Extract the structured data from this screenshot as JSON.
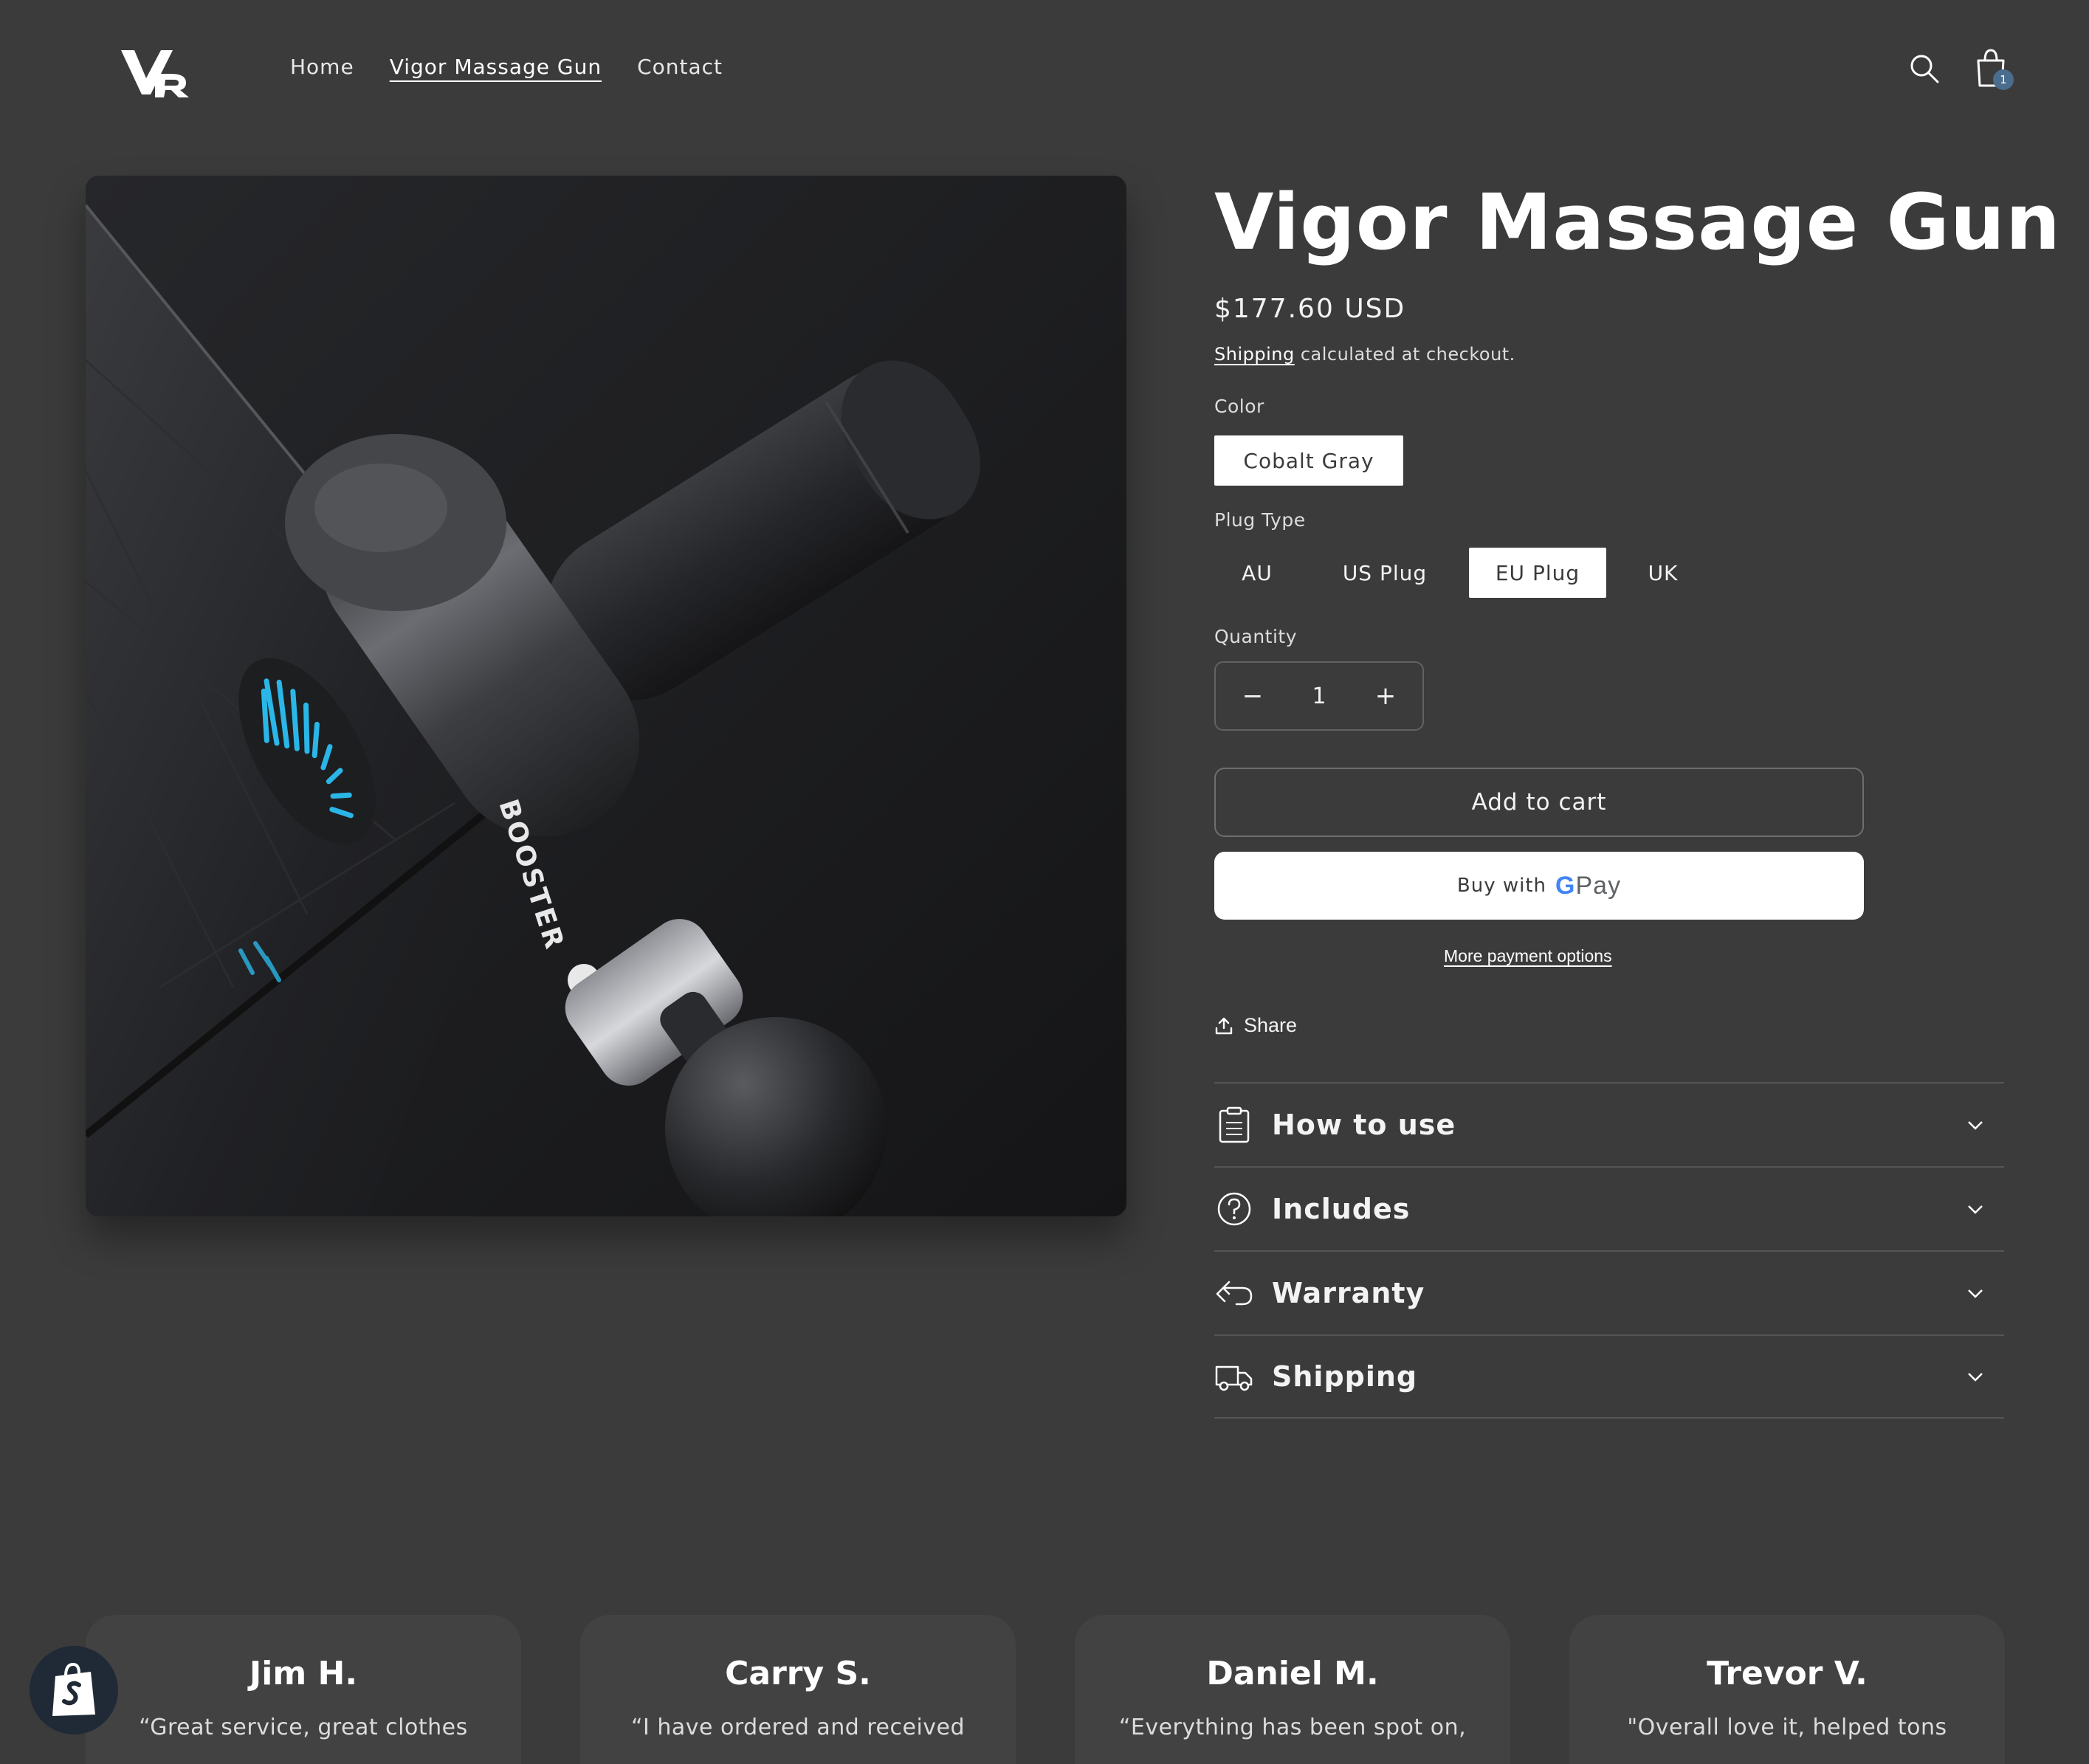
{
  "header": {
    "nav": [
      {
        "label": "Home",
        "active": false
      },
      {
        "label": "Vigor Massage Gun",
        "active": true
      },
      {
        "label": "Contact",
        "active": false
      }
    ],
    "cart_count": "1"
  },
  "product": {
    "title": "Vigor Massage Gun",
    "price": "$177.60 USD",
    "shipping_link": "Shipping",
    "shipping_note": " calculated at checkout.",
    "color_label": "Color",
    "color_options": [
      {
        "label": "Cobalt Gray",
        "selected": true
      }
    ],
    "plug_label": "Plug Type",
    "plug_options": [
      {
        "label": "AU",
        "selected": false
      },
      {
        "label": "US Plug",
        "selected": false
      },
      {
        "label": "EU Plug",
        "selected": true
      },
      {
        "label": "UK",
        "selected": false
      }
    ],
    "quantity_label": "Quantity",
    "quantity_minus": "−",
    "quantity_value": "1",
    "quantity_plus": "+",
    "add_to_cart": "Add to cart",
    "buy_with": "Buy with",
    "gpay_g": "G",
    "gpay_pay": "Pay",
    "more_payment": "More payment options",
    "share": "Share",
    "image_brand_text": "BOOSTER"
  },
  "accordion": [
    {
      "title": "How to use",
      "icon": "clipboard-icon"
    },
    {
      "title": "Includes",
      "icon": "question-circle-icon"
    },
    {
      "title": "Warranty",
      "icon": "return-arrow-icon"
    },
    {
      "title": "Shipping",
      "icon": "truck-icon"
    }
  ],
  "testimonials": [
    {
      "name": "Jim H.",
      "quote": "“Great service, great clothes"
    },
    {
      "name": "Carry S.",
      "quote": "“I have ordered and received"
    },
    {
      "name": "Daniel M.",
      "quote": "“Everything has been spot on,"
    },
    {
      "name": "Trevor V.",
      "quote": "\"Overall love it, helped tons"
    }
  ],
  "colors": {
    "background": "#3b3b3b",
    "accent_blue": "#2bb6e8",
    "cart_badge": "#4b6d8d"
  }
}
